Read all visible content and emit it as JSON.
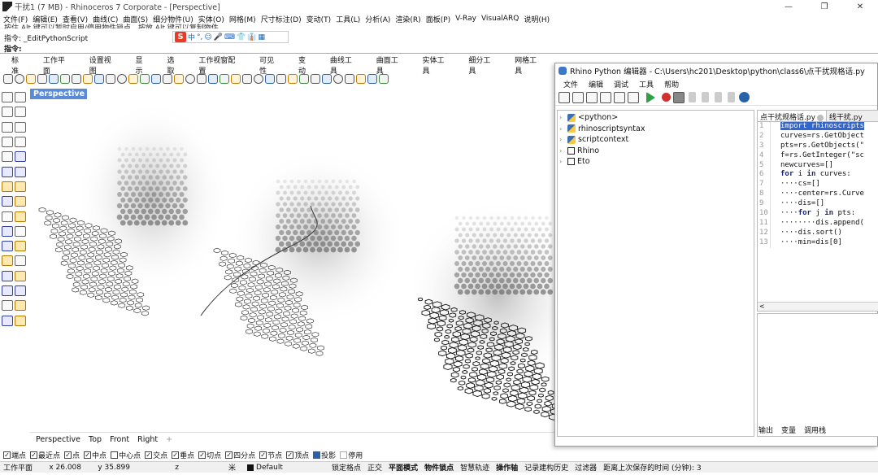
{
  "titlebar": {
    "title": "干扰1 (7 MB) - Rhinoceros 7 Corporate - [Perspective]",
    "minimize": "—",
    "maximize": "❐",
    "close": "✕"
  },
  "menubar": [
    "文件(F)",
    "编辑(E)",
    "查看(V)",
    "曲线(C)",
    "曲面(S)",
    "细分物件(U)",
    "实体(O)",
    "网格(M)",
    "尺寸标注(D)",
    "变动(T)",
    "工具(L)",
    "分析(A)",
    "渲染(R)",
    "面板(P)",
    "V-Ray",
    "VisualARQ",
    "说明(H)"
  ],
  "command": {
    "history": "按住 Alt 键可以暂时启用/停用物件锁点，按放 Alt 键可以复制物件",
    "last": "指令: _EditPythonScript",
    "prompt": "指令:"
  },
  "ime": {
    "logo": "S",
    "items": [
      "中",
      "°,",
      "☺",
      "🎤",
      "⌨",
      "👕",
      "👔",
      "▦"
    ]
  },
  "toolbar_tabs": [
    "标准",
    "工作平面",
    "设置视图",
    "显示",
    "选取",
    "工作视窗配置",
    "可见性",
    "变动",
    "曲线工具",
    "曲面工具",
    "实体工具",
    "细分工具",
    "网格工具"
  ],
  "viewport": {
    "name": "Perspective",
    "tabs": [
      "Perspective",
      "Top",
      "Front",
      "Right"
    ],
    "add": "+"
  },
  "snaps": [
    {
      "label": "端点",
      "checked": true
    },
    {
      "label": "最近点",
      "checked": true
    },
    {
      "label": "点",
      "checked": true
    },
    {
      "label": "中点",
      "checked": true
    },
    {
      "label": "中心点",
      "checked": false
    },
    {
      "label": "交点",
      "checked": true
    },
    {
      "label": "垂点",
      "checked": true
    },
    {
      "label": "切点",
      "checked": true
    },
    {
      "label": "四分点",
      "checked": true
    },
    {
      "label": "节点",
      "checked": true
    },
    {
      "label": "顶点",
      "checked": true
    },
    {
      "label": "投影",
      "checked": true
    },
    {
      "label": "停用",
      "checked": false
    }
  ],
  "status": {
    "cplane": "工作平面",
    "x": "x 26.008",
    "y": "y 35.899",
    "z": "z",
    "unit": "米",
    "layer": "Default",
    "items": [
      "锁定格点",
      "正交",
      "平面模式",
      "物件锁点",
      "智慧轨迹",
      "操作轴",
      "记录建构历史",
      "过滤器",
      "距离上次保存的时间 (分钟): 3"
    ],
    "bold": [
      "平面模式",
      "物件锁点",
      "操作轴"
    ]
  },
  "editor": {
    "title": "Rhino Python 编辑器 - C:\\Users\\hc201\\Desktop\\python\\class6\\点干扰规格话.py",
    "menu": [
      "文件",
      "编辑",
      "调试",
      "工具",
      "帮助"
    ],
    "tree": [
      {
        "label": "<python>",
        "icon": "python"
      },
      {
        "label": "rhinoscriptsyntax",
        "icon": "python"
      },
      {
        "label": "scriptcontext",
        "icon": "python"
      },
      {
        "label": "Rhino",
        "icon": "window"
      },
      {
        "label": "Eto",
        "icon": "window"
      }
    ],
    "tabs": [
      {
        "label": "点干扰规格话.py",
        "active": true
      },
      {
        "label": "线干扰.py",
        "active": false
      }
    ],
    "code": [
      {
        "n": "1",
        "t": "import rhinoscripts"
      },
      {
        "n": "2",
        "t": "curves=rs.GetObject"
      },
      {
        "n": "3",
        "t": "pts=rs.GetObjects(\""
      },
      {
        "n": "4",
        "t": "f=rs.GetInteger(\"sc"
      },
      {
        "n": "5",
        "t": "newcurves=[]"
      },
      {
        "n": "6",
        "t": "for i in curves:"
      },
      {
        "n": "7",
        "t": "····cs=[]"
      },
      {
        "n": "8",
        "t": "····center=rs.Curve"
      },
      {
        "n": "9",
        "t": "····dis=[]"
      },
      {
        "n": "10",
        "t": "····for j in pts:"
      },
      {
        "n": "11",
        "t": "········dis.append("
      },
      {
        "n": "12",
        "t": "····dis.sort()"
      },
      {
        "n": "13",
        "t": "····min=dis[0]"
      }
    ],
    "scroll_left": "<",
    "output_tabs": [
      "输出",
      "变量",
      "调用栈"
    ]
  }
}
